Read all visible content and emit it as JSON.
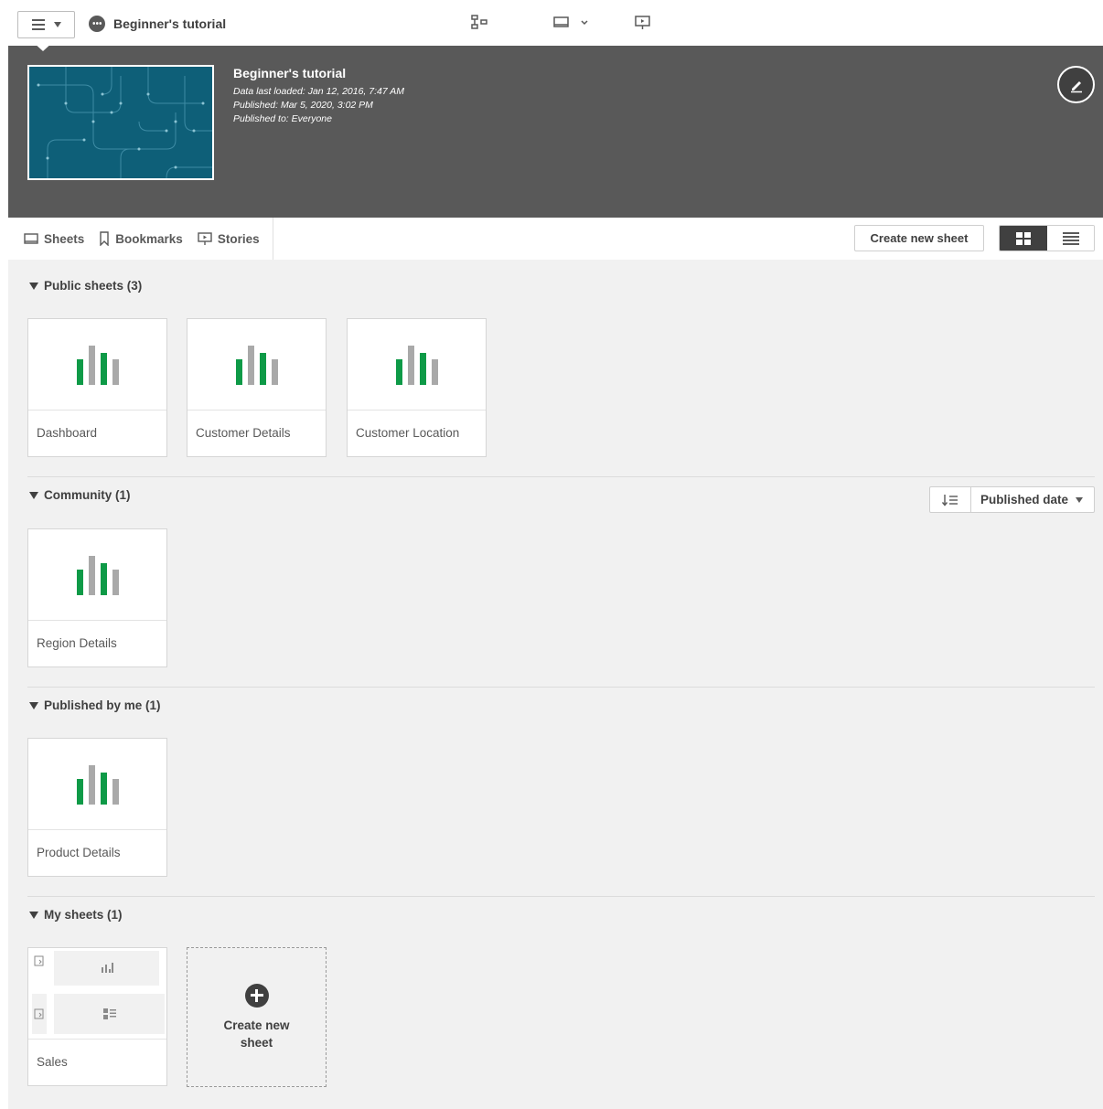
{
  "toolbar": {
    "app_name": "Beginner's tutorial"
  },
  "banner": {
    "title": "Beginner's tutorial",
    "data_loaded": "Data last loaded: Jan 12, 2016, 7:47 AM",
    "published": "Published: Mar 5, 2020, 3:02 PM",
    "published_to": "Published to: Everyone"
  },
  "tabs": [
    {
      "label": "Sheets"
    },
    {
      "label": "Bookmarks"
    },
    {
      "label": "Stories"
    }
  ],
  "actions": {
    "create_new_sheet": "Create new sheet"
  },
  "sections": {
    "public": {
      "title": "Public sheets (3)",
      "sheets": [
        "Dashboard",
        "Customer Details",
        "Customer Location"
      ]
    },
    "community": {
      "title": "Community (1)",
      "sheets": [
        "Region Details"
      ]
    },
    "published_by_me": {
      "title": "Published by me (1)",
      "sheets": [
        "Product Details"
      ]
    },
    "my_sheets": {
      "title": "My sheets (1)",
      "sheets": [
        "Sales"
      ],
      "create_label": "Create new sheet"
    }
  },
  "sort": {
    "selected": "Published date"
  },
  "colors": {
    "banner": "#595959",
    "thumbnail": "#0e5f78",
    "bar_green": "#0e9a47",
    "bar_gray": "#a9a9a9",
    "content_bg": "#f1f1f1"
  }
}
